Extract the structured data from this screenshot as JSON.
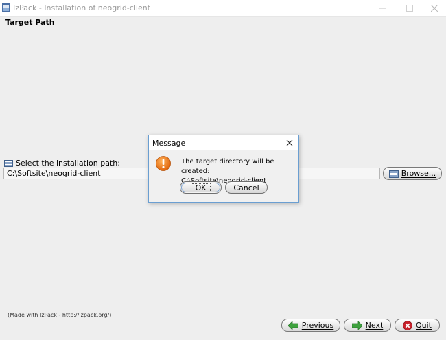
{
  "window": {
    "title": "IzPack - Installation of  neogrid-client",
    "minimize_icon": "minimize-icon",
    "maximize_icon": "maximize-icon",
    "close_icon": "close-icon"
  },
  "panel": {
    "title": "Target Path",
    "path_label": "Select the installation path:",
    "path_value": "C:\\Softsite\\neogrid-client",
    "browse_label": "Browse..."
  },
  "footer": {
    "made_with": "(Made with IzPack - http://izpack.org/)",
    "previous_label": "Previous",
    "next_label": "Next",
    "quit_label": "Quit"
  },
  "dialog": {
    "title": "Message",
    "message_line1": "The target directory will be created:",
    "message_line2": "C:\\Softsite\\neogrid-client",
    "ok_label": "OK",
    "cancel_label": "Cancel",
    "icon": "warning-icon"
  },
  "colors": {
    "dialog_border": "#6a9ed1",
    "warning_orange": "#f07d1a",
    "previous_arrow": "#3ea23e",
    "quit_red": "#c8202a"
  }
}
